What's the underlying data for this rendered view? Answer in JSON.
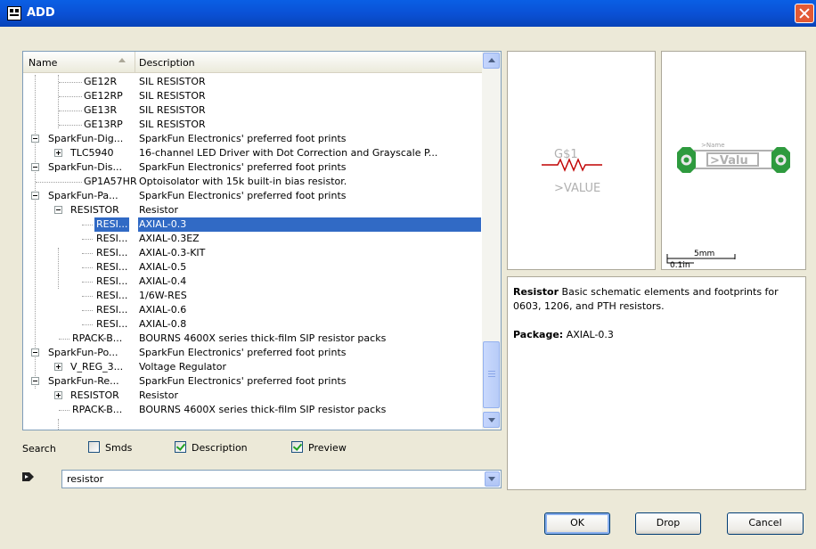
{
  "window": {
    "title": "ADD",
    "close_icon": "close-icon"
  },
  "tree": {
    "columns": {
      "name": "Name",
      "description": "Description"
    },
    "rows": [
      {
        "name": "GE12R",
        "description": "SIL RESISTOR"
      },
      {
        "name": "GE12RP",
        "description": "SIL RESISTOR"
      },
      {
        "name": "GE13R",
        "description": "SIL RESISTOR"
      },
      {
        "name": "GE13RP",
        "description": "SIL RESISTOR"
      },
      {
        "name": "SparkFun-Dig...",
        "description": "SparkFun Electronics' preferred foot prints"
      },
      {
        "name": "TLC5940",
        "description": "16-channel LED Driver with Dot Correction and Grayscale P..."
      },
      {
        "name": "SparkFun-Dis...",
        "description": "SparkFun Electronics' preferred foot prints"
      },
      {
        "name": "GP1A57HR",
        "description": "Optoisolator with 15k built-in bias resistor."
      },
      {
        "name": "SparkFun-Pa...",
        "description": "SparkFun Electronics' preferred foot prints"
      },
      {
        "name": "RESISTOR",
        "description": "Resistor"
      },
      {
        "name": "RESI...",
        "description": "AXIAL-0.3"
      },
      {
        "name": "RESI...",
        "description": "AXIAL-0.3EZ"
      },
      {
        "name": "RESI...",
        "description": "AXIAL-0.3-KIT"
      },
      {
        "name": "RESI...",
        "description": "AXIAL-0.5"
      },
      {
        "name": "RESI...",
        "description": "AXIAL-0.4"
      },
      {
        "name": "RESI...",
        "description": "1/6W-RES"
      },
      {
        "name": "RESI...",
        "description": "AXIAL-0.6"
      },
      {
        "name": "RESI...",
        "description": "AXIAL-0.8"
      },
      {
        "name": "RPACK-B...",
        "description": "BOURNS 4600X series thick-film SIP resistor packs"
      },
      {
        "name": "SparkFun-Po...",
        "description": "SparkFun Electronics' preferred foot prints"
      },
      {
        "name": "V_REG_3...",
        "description": "Voltage Regulator"
      },
      {
        "name": "SparkFun-Re...",
        "description": "SparkFun Electronics' preferred foot prints"
      },
      {
        "name": "RESISTOR",
        "description": "Resistor"
      },
      {
        "name": "RPACK-B...",
        "description": "BOURNS 4600X series thick-film SIP resistor packs"
      }
    ]
  },
  "search": {
    "label": "Search",
    "smds_label": "Smds",
    "smds_checked": false,
    "description_label": "Description",
    "description_checked": true,
    "preview_label": "Preview",
    "preview_checked": true,
    "value": "resistor"
  },
  "preview": {
    "symbol_name": "G$1",
    "symbol_value": ">VALUE",
    "package_name": ">Name",
    "package_value": ">Valu",
    "scale_mm": "5mm",
    "scale_in": "0.1in"
  },
  "description_panel": {
    "title": "Resistor",
    "text": "Basic schematic elements and footprints for 0603, 1206, and PTH resistors.",
    "package_label": "Package:",
    "package_value": "AXIAL-0.3"
  },
  "buttons": {
    "ok": "OK",
    "drop": "Drop",
    "cancel": "Cancel"
  },
  "colors": {
    "titlebar": "#0a51d6",
    "selection": "#316ac5",
    "symbol": "#c00000",
    "pad": "#2e9a3e"
  }
}
